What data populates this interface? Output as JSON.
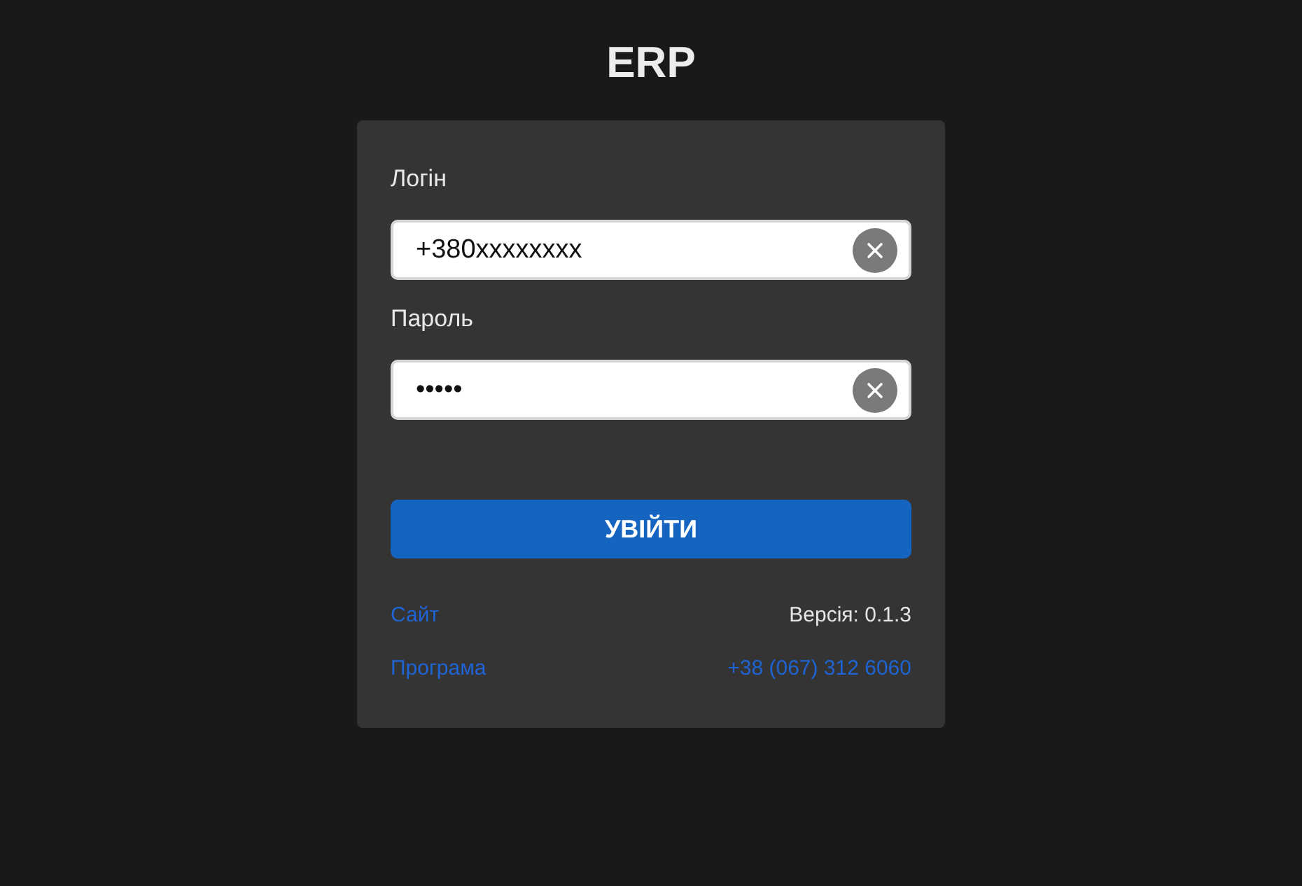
{
  "title": "ERP",
  "form": {
    "fields": [
      {
        "label": "Логін",
        "kind": "text",
        "value": "+380xxxxxxxx"
      },
      {
        "label": "Пароль",
        "kind": "password",
        "value": "•••••"
      }
    ],
    "submit_button": "УВІЙТИ",
    "footer": [
      {
        "left": {
          "text": "Сайт",
          "kind": "link"
        },
        "right": {
          "text": "Версія: 0.1.3",
          "kind": "text"
        }
      },
      {
        "left": {
          "text": "Програма",
          "kind": "link"
        },
        "right": {
          "text": "+38 (067) 312 6060",
          "kind": "link"
        }
      }
    ]
  }
}
